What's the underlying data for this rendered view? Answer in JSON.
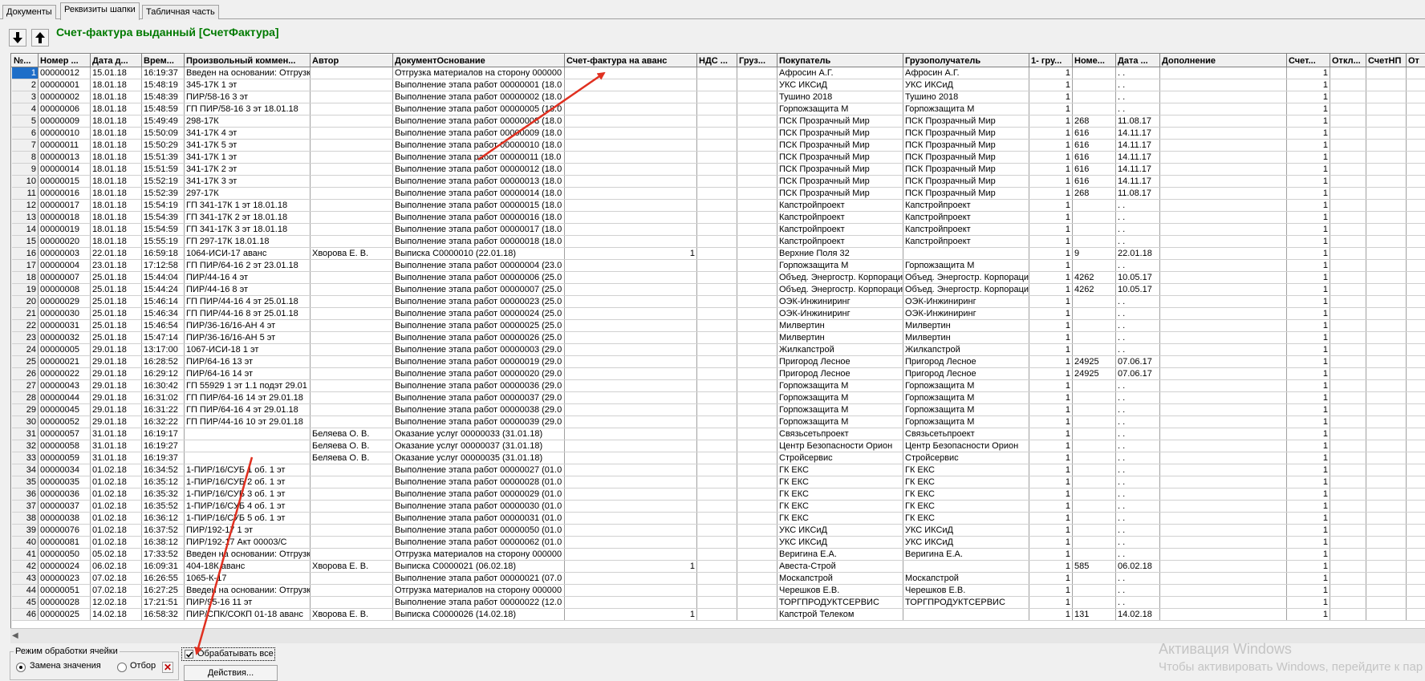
{
  "tabs": [
    "Документы",
    "Реквизиты шапки",
    "Табличная часть"
  ],
  "toolbar": {
    "title": "Счет-фактура выданный [СчетФактура]",
    "down_icon": "arrow-down-icon",
    "up_icon": "arrow-up-icon"
  },
  "table": {
    "columns": [
      "№...",
      "Номер ...",
      "Дата д...",
      "Врем...",
      "Произвольный коммен...",
      "Автор",
      "ДокументОснование",
      "Счет-фактура на аванс",
      "НДС ...",
      "Груз...",
      "Покупатель",
      "Грузополучатель",
      "1- гру...",
      "Номе...",
      "Дата ...",
      "Дополнение",
      "Счет...",
      "Откл...",
      "СчетНП",
      "От"
    ],
    "rows": [
      [
        "1",
        "00000012",
        "15.01.18",
        "16:19:37",
        "Введен на основании: Отгрузк",
        "",
        "Отгрузка материалов на сторону 000000",
        "",
        "",
        "",
        "Афросин А.Г.",
        "Афросин А.Г.",
        "1",
        "",
        "  .  .",
        "",
        "1",
        "",
        "",
        ""
      ],
      [
        "2",
        "00000001",
        "18.01.18",
        "15:48:19",
        "345-17К 1 эт",
        "",
        "Выполнение этапа работ 00000001 (18.0",
        "",
        "",
        "",
        "УКС ИКСиД",
        "УКС ИКСиД",
        "1",
        "",
        "  .  .",
        "",
        "1",
        "",
        "",
        ""
      ],
      [
        "3",
        "00000002",
        "18.01.18",
        "15:48:39",
        "ПИР/58-16  3 эт",
        "",
        "Выполнение этапа работ 00000002 (18.0",
        "",
        "",
        "",
        "Тушино 2018",
        "Тушино 2018",
        "1",
        "",
        "  .  .",
        "",
        "1",
        "",
        "",
        ""
      ],
      [
        "4",
        "00000006",
        "18.01.18",
        "15:48:59",
        "ГП ПИР/58-16 3 эт 18.01.18",
        "",
        "Выполнение этапа работ 00000005 (18.0",
        "",
        "",
        "",
        "Горпожзащита М",
        "Горпожзащита М",
        "1",
        "",
        "  .  .",
        "",
        "1",
        "",
        "",
        ""
      ],
      [
        "5",
        "00000009",
        "18.01.18",
        "15:49:49",
        "298-17К",
        "",
        "Выполнение этапа работ 00000008 (18.0",
        "",
        "",
        "",
        "ПСК Прозрачный Мир",
        "ПСК Прозрачный Мир",
        "1",
        "268",
        "11.08.17",
        "",
        "1",
        "",
        "",
        ""
      ],
      [
        "6",
        "00000010",
        "18.01.18",
        "15:50:09",
        "341-17К 4 эт",
        "",
        "Выполнение этапа работ 00000009 (18.0",
        "",
        "",
        "",
        "ПСК Прозрачный Мир",
        "ПСК Прозрачный Мир",
        "1",
        "616",
        "14.11.17",
        "",
        "1",
        "",
        "",
        ""
      ],
      [
        "7",
        "00000011",
        "18.01.18",
        "15:50:29",
        "341-17К 5 эт",
        "",
        "Выполнение этапа работ 00000010 (18.0",
        "",
        "",
        "",
        "ПСК Прозрачный Мир",
        "ПСК Прозрачный Мир",
        "1",
        "616",
        "14.11.17",
        "",
        "1",
        "",
        "",
        ""
      ],
      [
        "8",
        "00000013",
        "18.01.18",
        "15:51:39",
        "341-17К 1 эт",
        "",
        "Выполнение этапа работ 00000011 (18.0",
        "",
        "",
        "",
        "ПСК Прозрачный Мир",
        "ПСК Прозрачный Мир",
        "1",
        "616",
        "14.11.17",
        "",
        "1",
        "",
        "",
        ""
      ],
      [
        "9",
        "00000014",
        "18.01.18",
        "15:51:59",
        "341-17К 2 эт",
        "",
        "Выполнение этапа работ 00000012 (18.0",
        "",
        "",
        "",
        "ПСК Прозрачный Мир",
        "ПСК Прозрачный Мир",
        "1",
        "616",
        "14.11.17",
        "",
        "1",
        "",
        "",
        ""
      ],
      [
        "10",
        "00000015",
        "18.01.18",
        "15:52:19",
        "341-17К 3 эт",
        "",
        "Выполнение этапа работ 00000013 (18.0",
        "",
        "",
        "",
        "ПСК Прозрачный Мир",
        "ПСК Прозрачный Мир",
        "1",
        "616",
        "14.11.17",
        "",
        "1",
        "",
        "",
        ""
      ],
      [
        "11",
        "00000016",
        "18.01.18",
        "15:52:39",
        "297-17К",
        "",
        "Выполнение этапа работ 00000014 (18.0",
        "",
        "",
        "",
        "ПСК Прозрачный Мир",
        "ПСК Прозрачный Мир",
        "1",
        "268",
        "11.08.17",
        "",
        "1",
        "",
        "",
        ""
      ],
      [
        "12",
        "00000017",
        "18.01.18",
        "15:54:19",
        "ГП 341-17К 1 эт 18.01.18",
        "",
        "Выполнение этапа работ 00000015 (18.0",
        "",
        "",
        "",
        "Капстройпроект",
        "Капстройпроект",
        "1",
        "",
        "  .  .",
        "",
        "1",
        "",
        "",
        ""
      ],
      [
        "13",
        "00000018",
        "18.01.18",
        "15:54:39",
        "ГП 341-17К 2 эт 18.01.18",
        "",
        "Выполнение этапа работ 00000016 (18.0",
        "",
        "",
        "",
        "Капстройпроект",
        "Капстройпроект",
        "1",
        "",
        "  .  .",
        "",
        "1",
        "",
        "",
        ""
      ],
      [
        "14",
        "00000019",
        "18.01.18",
        "15:54:59",
        "ГП 341-17К 3 эт 18.01.18",
        "",
        "Выполнение этапа работ 00000017 (18.0",
        "",
        "",
        "",
        "Капстройпроект",
        "Капстройпроект",
        "1",
        "",
        "  .  .",
        "",
        "1",
        "",
        "",
        ""
      ],
      [
        "15",
        "00000020",
        "18.01.18",
        "15:55:19",
        "ГП 297-17К 18.01.18",
        "",
        "Выполнение этапа работ 00000018 (18.0",
        "",
        "",
        "",
        "Капстройпроект",
        "Капстройпроект",
        "1",
        "",
        "  .  .",
        "",
        "1",
        "",
        "",
        ""
      ],
      [
        "16",
        "00000003",
        "22.01.18",
        "16:59:18",
        "1064-ИСИ-17 аванс",
        "Хворова Е. В.",
        "Выписка С0000010 (22.01.18)",
        "1",
        "",
        "",
        "Верхние Поля 32",
        "",
        "1",
        "9",
        "22.01.18",
        "",
        "1",
        "",
        "",
        ""
      ],
      [
        "17",
        "00000004",
        "23.01.18",
        "17:12:58",
        "ГП ПИР/64-16 2 эт 23.01.18",
        "",
        "Выполнение этапа работ 00000004 (23.0",
        "",
        "",
        "",
        "Горпожзащита М",
        "Горпожзащита М",
        "1",
        "",
        "  .  .",
        "",
        "1",
        "",
        "",
        ""
      ],
      [
        "18",
        "00000007",
        "25.01.18",
        "15:44:04",
        "ПИР/44-16  4 эт",
        "",
        "Выполнение этапа работ 00000006 (25.0",
        "",
        "",
        "",
        "Объед. Энергостр. Корпораци",
        "Объед. Энергостр. Корпораци",
        "1",
        "4262",
        "10.05.17",
        "",
        "1",
        "",
        "",
        ""
      ],
      [
        "19",
        "00000008",
        "25.01.18",
        "15:44:24",
        "ПИР/44-16  8 эт",
        "",
        "Выполнение этапа работ 00000007 (25.0",
        "",
        "",
        "",
        "Объед. Энергостр. Корпораци",
        "Объед. Энергостр. Корпораци",
        "1",
        "4262",
        "10.05.17",
        "",
        "1",
        "",
        "",
        ""
      ],
      [
        "20",
        "00000029",
        "25.01.18",
        "15:46:14",
        "ГП ПИР/44-16  4 эт 25.01.18",
        "",
        "Выполнение этапа работ 00000023 (25.0",
        "",
        "",
        "",
        "ОЭК-Инжиниринг",
        "ОЭК-Инжиниринг",
        "1",
        "",
        "  .  .",
        "",
        "1",
        "",
        "",
        ""
      ],
      [
        "21",
        "00000030",
        "25.01.18",
        "15:46:34",
        "ГП ПИР/44-16  8 эт 25.01.18",
        "",
        "Выполнение этапа работ 00000024 (25.0",
        "",
        "",
        "",
        "ОЭК-Инжиниринг",
        "ОЭК-Инжиниринг",
        "1",
        "",
        "  .  .",
        "",
        "1",
        "",
        "",
        ""
      ],
      [
        "22",
        "00000031",
        "25.01.18",
        "15:46:54",
        "ПИР/36-16/16-АН  4 эт",
        "",
        "Выполнение этапа работ 00000025 (25.0",
        "",
        "",
        "",
        "Милвертин",
        "Милвертин",
        "1",
        "",
        "  .  .",
        "",
        "1",
        "",
        "",
        ""
      ],
      [
        "23",
        "00000032",
        "25.01.18",
        "15:47:14",
        "ПИР/36-16/16-АН  5 эт",
        "",
        "Выполнение этапа работ 00000026 (25.0",
        "",
        "",
        "",
        "Милвертин",
        "Милвертин",
        "1",
        "",
        "  .  .",
        "",
        "1",
        "",
        "",
        ""
      ],
      [
        "24",
        "00000005",
        "29.01.18",
        "13:17:00",
        "1067-ИСИ-18  1 эт",
        "",
        "Выполнение этапа работ 00000003 (29.0",
        "",
        "",
        "",
        "Жилкапстрой",
        "Жилкапстрой",
        "1",
        "",
        "  .  .",
        "",
        "1",
        "",
        "",
        ""
      ],
      [
        "25",
        "00000021",
        "29.01.18",
        "16:28:52",
        "ПИР/64-16  13 эт",
        "",
        "Выполнение этапа работ 00000019 (29.0",
        "",
        "",
        "",
        "Пригород Лесное",
        "Пригород Лесное",
        "1",
        "24925",
        "07.06.17",
        "",
        "1",
        "",
        "",
        ""
      ],
      [
        "26",
        "00000022",
        "29.01.18",
        "16:29:12",
        "ПИР/64-16  14 эт",
        "",
        "Выполнение этапа работ 00000020 (29.0",
        "",
        "",
        "",
        "Пригород Лесное",
        "Пригород Лесное",
        "1",
        "24925",
        "07.06.17",
        "",
        "1",
        "",
        "",
        ""
      ],
      [
        "27",
        "00000043",
        "29.01.18",
        "16:30:42",
        "ГП 55929 1 эт 1.1 подэт 29.01",
        "",
        "Выполнение этапа работ 00000036 (29.0",
        "",
        "",
        "",
        "Горпожзащита М",
        "Горпожзащита М",
        "1",
        "",
        "  .  .",
        "",
        "1",
        "",
        "",
        ""
      ],
      [
        "28",
        "00000044",
        "29.01.18",
        "16:31:02",
        "ГП ПИР/64-16 14 эт 29.01.18",
        "",
        "Выполнение этапа работ 00000037 (29.0",
        "",
        "",
        "",
        "Горпожзащита М",
        "Горпожзащита М",
        "1",
        "",
        "  .  .",
        "",
        "1",
        "",
        "",
        ""
      ],
      [
        "29",
        "00000045",
        "29.01.18",
        "16:31:22",
        "ГП ПИР/64-16 4 эт 29.01.18",
        "",
        "Выполнение этапа работ 00000038 (29.0",
        "",
        "",
        "",
        "Горпожзащита М",
        "Горпожзащита М",
        "1",
        "",
        "  .  .",
        "",
        "1",
        "",
        "",
        ""
      ],
      [
        "30",
        "00000052",
        "29.01.18",
        "16:32:22",
        "ГП ПИР/44-16 10 эт 29.01.18",
        "",
        "Выполнение этапа работ 00000039 (29.0",
        "",
        "",
        "",
        "Горпожзащита М",
        "Горпожзащита М",
        "1",
        "",
        "  .  .",
        "",
        "1",
        "",
        "",
        ""
      ],
      [
        "31",
        "00000057",
        "31.01.18",
        "16:19:17",
        "",
        "Беляева О. В.",
        "Оказание услуг 00000033 (31.01.18)",
        "",
        "",
        "",
        "Связьсетьпроект",
        "Связьсетьпроект",
        "1",
        "",
        "  .  .",
        "",
        "1",
        "",
        "",
        ""
      ],
      [
        "32",
        "00000058",
        "31.01.18",
        "16:19:27",
        "",
        "Беляева О. В.",
        "Оказание услуг 00000037 (31.01.18)",
        "",
        "",
        "",
        "Центр Безопасности Орион",
        "Центр Безопасности Орион",
        "1",
        "",
        "  .  .",
        "",
        "1",
        "",
        "",
        ""
      ],
      [
        "33",
        "00000059",
        "31.01.18",
        "16:19:37",
        "",
        "Беляева О. В.",
        "Оказание услуг 00000035 (31.01.18)",
        "",
        "",
        "",
        "Стройсервис",
        "Стройсервис",
        "1",
        "",
        "  .  .",
        "",
        "1",
        "",
        "",
        ""
      ],
      [
        "34",
        "00000034",
        "01.02.18",
        "16:34:52",
        "1-ПИР/16/СУБ 1 об. 1 эт",
        "",
        "Выполнение этапа работ 00000027 (01.0",
        "",
        "",
        "",
        "ГК ЕКС",
        "ГК ЕКС",
        "1",
        "",
        "  .  .",
        "",
        "1",
        "",
        "",
        ""
      ],
      [
        "35",
        "00000035",
        "01.02.18",
        "16:35:12",
        "1-ПИР/16/СУБ 2 об. 1 эт",
        "",
        "Выполнение этапа работ 00000028 (01.0",
        "",
        "",
        "",
        "ГК ЕКС",
        "ГК ЕКС",
        "1",
        "",
        "  .  .",
        "",
        "1",
        "",
        "",
        ""
      ],
      [
        "36",
        "00000036",
        "01.02.18",
        "16:35:32",
        "1-ПИР/16/СУБ 3 об. 1 эт",
        "",
        "Выполнение этапа работ 00000029 (01.0",
        "",
        "",
        "",
        "ГК ЕКС",
        "ГК ЕКС",
        "1",
        "",
        "  .  .",
        "",
        "1",
        "",
        "",
        ""
      ],
      [
        "37",
        "00000037",
        "01.02.18",
        "16:35:52",
        "1-ПИР/16/СУБ 4 об. 1 эт",
        "",
        "Выполнение этапа работ 00000030 (01.0",
        "",
        "",
        "",
        "ГК ЕКС",
        "ГК ЕКС",
        "1",
        "",
        "  .  .",
        "",
        "1",
        "",
        "",
        ""
      ],
      [
        "38",
        "00000038",
        "01.02.18",
        "16:36:12",
        "1-ПИР/16/СУБ 5 об. 1 эт",
        "",
        "Выполнение этапа работ 00000031 (01.0",
        "",
        "",
        "",
        "ГК ЕКС",
        "ГК ЕКС",
        "1",
        "",
        "  .  .",
        "",
        "1",
        "",
        "",
        ""
      ],
      [
        "39",
        "00000076",
        "01.02.18",
        "16:37:52",
        "ПИР/192-17 1 эт",
        "",
        "Выполнение этапа работ 00000050 (01.0",
        "",
        "",
        "",
        "УКС ИКСиД",
        "УКС ИКСиД",
        "1",
        "",
        "  .  .",
        "",
        "1",
        "",
        "",
        ""
      ],
      [
        "40",
        "00000081",
        "01.02.18",
        "16:38:12",
        "ПИР/192-17 Акт 00003/С",
        "",
        "Выполнение этапа работ 00000062 (01.0",
        "",
        "",
        "",
        "УКС ИКСиД",
        "УКС ИКСиД",
        "1",
        "",
        "  .  .",
        "",
        "1",
        "",
        "",
        ""
      ],
      [
        "41",
        "00000050",
        "05.02.18",
        "17:33:52",
        "Введен на основании: Отгрузк",
        "",
        "Отгрузка материалов на сторону 000000",
        "",
        "",
        "",
        "Веригина Е.А.",
        "Веригина Е.А.",
        "1",
        "",
        "  .  .",
        "",
        "1",
        "",
        "",
        ""
      ],
      [
        "42",
        "00000024",
        "06.02.18",
        "16:09:31",
        "404-18К аванс",
        "Хворова Е. В.",
        "Выписка С0000021 (06.02.18)",
        "1",
        "",
        "",
        "Авеста-Строй",
        "",
        "1",
        "585",
        "06.02.18",
        "",
        "1",
        "",
        "",
        ""
      ],
      [
        "43",
        "00000023",
        "07.02.18",
        "16:26:55",
        "1065-К-17",
        "",
        "Выполнение этапа работ 00000021 (07.0",
        "",
        "",
        "",
        "Москапстрой",
        "Москапстрой",
        "1",
        "",
        "  .  .",
        "",
        "1",
        "",
        "",
        ""
      ],
      [
        "44",
        "00000051",
        "07.02.18",
        "16:27:25",
        "Введен на основании: Отгрузк",
        "",
        "Отгрузка материалов на сторону 000000",
        "",
        "",
        "",
        "Черешков Е.В.",
        "Черешков Е.В.",
        "1",
        "",
        "  .  .",
        "",
        "1",
        "",
        "",
        ""
      ],
      [
        "45",
        "00000028",
        "12.02.18",
        "17:21:51",
        "ПИР/95-16 11 эт",
        "",
        "Выполнение этапа работ 00000022 (12.0",
        "",
        "",
        "",
        "ТОРГПРОДУКТСЕРВИС",
        "ТОРГПРОДУКТСЕРВИС",
        "1",
        "",
        "  .  .",
        "",
        "1",
        "",
        "",
        ""
      ],
      [
        "46",
        "00000025",
        "14.02.18",
        "16:58:32",
        "ПИР/СПК/СОКП 01-18 аванс",
        "Хворова Е. В.",
        "Выписка С0000026 (14.02.18)",
        "1",
        "",
        "",
        "Капстрой Телеком",
        "",
        "1",
        "131",
        "14.02.18",
        "",
        "1",
        "",
        "",
        ""
      ]
    ]
  },
  "bottom": {
    "group_label": "Режим обработки ячейки",
    "radio_replace": "Замена значения",
    "radio_select": "Отбор",
    "checkbox_label": "Обрабатывать все",
    "actions_button": "Действия..."
  },
  "watermark": {
    "line1": "Активация Windows",
    "line2": "Чтобы активировать Windows, перейдите к пар"
  },
  "colors": {
    "title": "#007a00",
    "selection": "#1e6ec8",
    "annotation_arrow": "#e03020"
  }
}
